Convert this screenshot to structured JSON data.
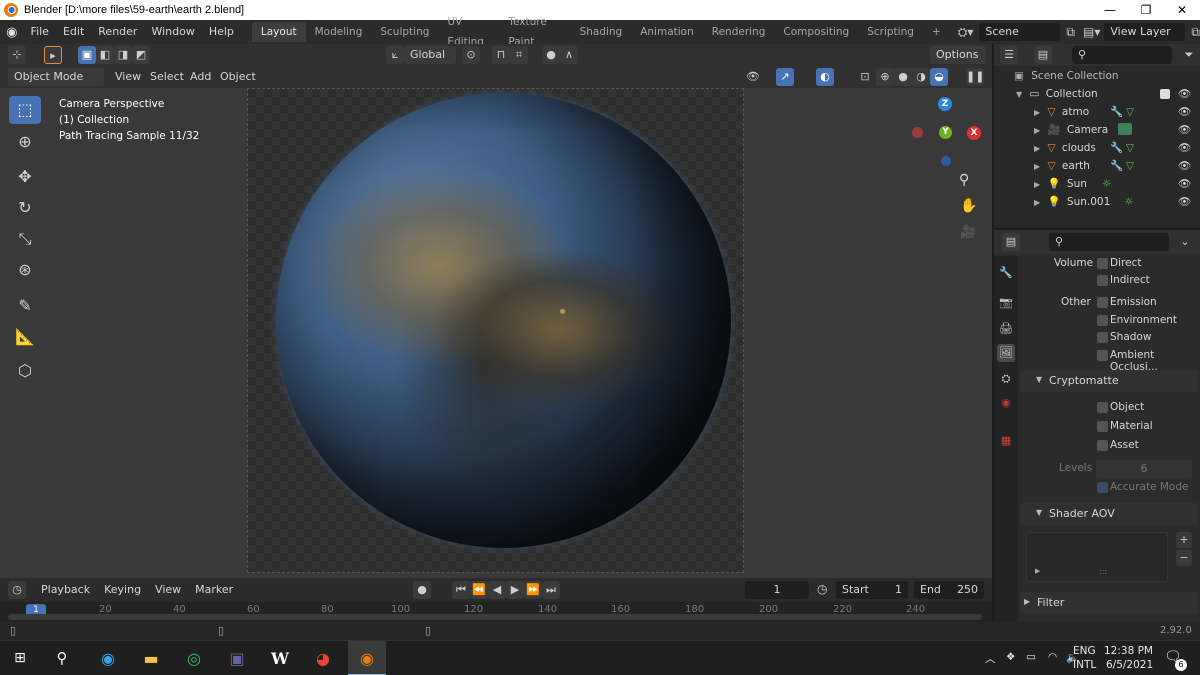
{
  "window": {
    "title": "Blender [D:\\more files\\59-earth\\earth 2.blend]",
    "min": "—",
    "max": "❐",
    "close": "✕"
  },
  "menus": [
    "File",
    "Edit",
    "Render",
    "Window",
    "Help"
  ],
  "workspaces": [
    "Layout",
    "Modeling",
    "Sculpting",
    "UV Editing",
    "Texture Paint",
    "Shading",
    "Animation",
    "Rendering",
    "Compositing",
    "Scripting"
  ],
  "active_workspace": "Layout",
  "add_workspace": "+",
  "scene": {
    "label": "Scene",
    "view_layer": "View Layer"
  },
  "header": {
    "transform_orientation": "Global",
    "options": "Options",
    "mode": "Object Mode",
    "view_menu": [
      "View",
      "Select",
      "Add",
      "Object"
    ]
  },
  "viewport_info": {
    "line1": "Camera Perspective",
    "line2": "(1) Collection",
    "line3": "Path Tracing Sample 11/32"
  },
  "gizmo": {
    "z": "Z",
    "y": "Y",
    "x": "X"
  },
  "outliner": {
    "root": "Scene Collection",
    "collection": "Collection",
    "items": [
      {
        "name": "atmo",
        "type": "mesh"
      },
      {
        "name": "Camera",
        "type": "camera"
      },
      {
        "name": "clouds",
        "type": "mesh"
      },
      {
        "name": "earth",
        "type": "mesh"
      },
      {
        "name": "Sun",
        "type": "light"
      },
      {
        "name": "Sun.001",
        "type": "light"
      }
    ]
  },
  "properties": {
    "volume_label": "Volume",
    "other_label": "Other",
    "volume": [
      "Direct",
      "Indirect"
    ],
    "other": [
      "Emission",
      "Environment",
      "Shadow",
      "Ambient Occlusi..."
    ],
    "cryptomatte_title": "Cryptomatte",
    "cryptomatte": [
      "Object",
      "Material",
      "Asset"
    ],
    "levels_label": "Levels",
    "levels_value": "6",
    "accurate_mode": "Accurate Mode",
    "shader_aov": "Shader AOV",
    "aov_plus": "+",
    "aov_minus": "−",
    "filter": "Filter"
  },
  "timeline": {
    "menus": [
      "Playback",
      "Keying",
      "View",
      "Marker"
    ],
    "current_frame": "1",
    "start_label": "Start",
    "start": "1",
    "end_label": "End",
    "end": "250",
    "ticks": [
      "1",
      "20",
      "40",
      "60",
      "80",
      "100",
      "120",
      "140",
      "160",
      "180",
      "200",
      "220",
      "240"
    ]
  },
  "status": {
    "version": "2.92.0"
  },
  "taskbar": {
    "lang1": "ENG",
    "lang2": "INTL",
    "time": "12:38 PM",
    "date": "6/5/2021",
    "notif": "6"
  },
  "colors": {
    "accent": "#4772b3",
    "x_axis": "#e03030",
    "y_axis": "#70b020",
    "z_axis": "#2e86de",
    "mesh": "#e8902e"
  }
}
